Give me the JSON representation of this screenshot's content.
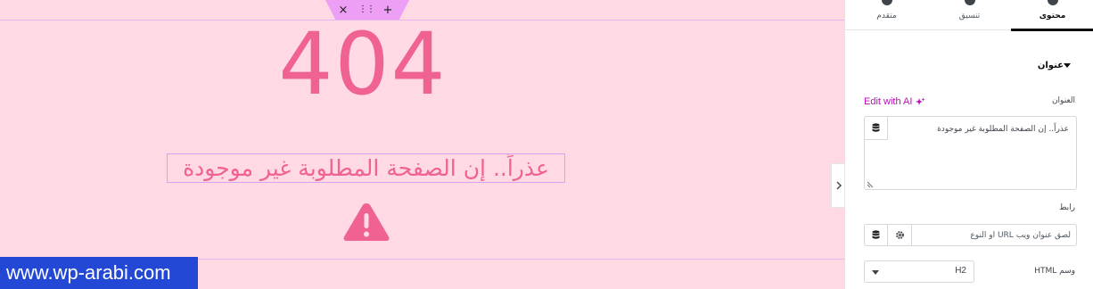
{
  "canvas": {
    "big_number": "404",
    "heading_text": "عذراً.. إن الصفحة المطلوبة غير موجودة",
    "watermark": "www.wp-arabi.com",
    "handle_close": "×",
    "handle_drag": "⋮⋮",
    "handle_add": "+",
    "accent_color": "#f06292",
    "background_color": "#ffd9e3"
  },
  "panel": {
    "tabs": [
      {
        "label": "محتوى",
        "active": true
      },
      {
        "label": "تنسيق",
        "active": false
      },
      {
        "label": "متقدم",
        "active": false
      }
    ],
    "section_title": "عنوان",
    "title_label": "العنوان",
    "edit_ai_label": "Edit with AI",
    "title_value": "عذراً.. إن الصفحة المطلوبة غير موجودة",
    "link_label": "رابط",
    "link_placeholder": "لصق عنوان ويب URL أو النوع",
    "html_tag_label": "وسم HTML",
    "html_tag_value": "H2",
    "ai_color": "#c00bb9"
  }
}
